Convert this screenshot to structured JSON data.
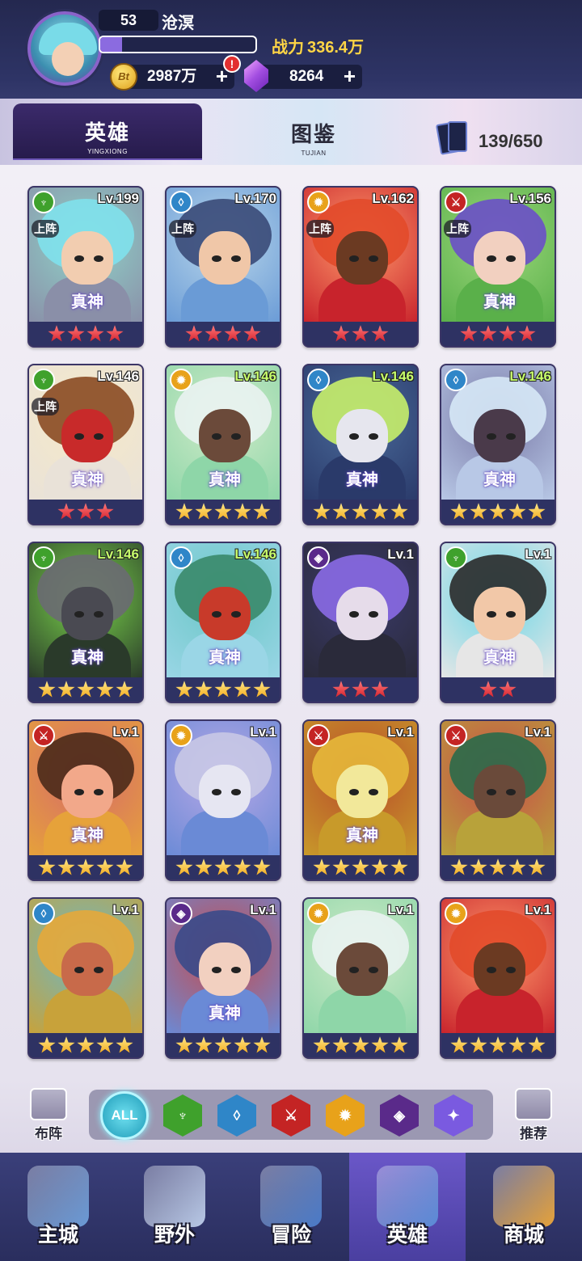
{
  "player": {
    "level": "53",
    "name": "沧溟",
    "exp_fraction": 0.14,
    "power_label": "战力",
    "power_value": "336.4万",
    "coins": "2987万",
    "gems": "8264",
    "coin_icon_text": "Bt",
    "alert": "!"
  },
  "tabs": {
    "hero_label": "英雄",
    "hero_sub": "YINGXIONG",
    "book_label": "图鉴",
    "book_sub": "TUJIAN",
    "collection_count": "139/650"
  },
  "labels": {
    "deployed": "上阵",
    "true_god": "真神"
  },
  "heroes": [
    {
      "level": "Lv.199",
      "faction": "nature",
      "stars": 4,
      "star_color": "red",
      "deployed": true,
      "god": true,
      "art": [
        "#8fd3c8",
        "#7fe1ec",
        "#f2cdb0",
        "#8a8fa8"
      ]
    },
    {
      "level": "Lv.170",
      "faction": "water",
      "stars": 4,
      "star_color": "red",
      "deployed": true,
      "god": false,
      "art": [
        "#b8d6ea",
        "#3a4a78",
        "#f0c7a8",
        "#6a9bd6"
      ]
    },
    {
      "level": "Lv.162",
      "faction": "light",
      "stars": 3,
      "star_color": "red",
      "deployed": true,
      "god": false,
      "art": [
        "#ff9a6a",
        "#e24a2a",
        "#6b3a22",
        "#c8232c"
      ]
    },
    {
      "level": "Lv.156",
      "faction": "fire",
      "stars": 4,
      "star_color": "red",
      "deployed": true,
      "god": true,
      "art": [
        "#9ad67a",
        "#6a4fc8",
        "#f2d0c0",
        "#5ab04a"
      ]
    },
    {
      "level": "Lv.146",
      "faction": "nature",
      "stars": 3,
      "star_color": "red",
      "deployed": true,
      "god": true,
      "art": [
        "#f6e9c8",
        "#8a4a22",
        "#c82a2a",
        "#e9e2d8"
      ]
    },
    {
      "level": "Lv.146",
      "faction": "light",
      "stars": 5,
      "star_color": "gold",
      "deployed": false,
      "god": true,
      "art": [
        "#cfeac8",
        "#eaf3f2",
        "#6b4a3a",
        "#8ed6a8"
      ]
    },
    {
      "level": "Lv.146",
      "faction": "water",
      "stars": 5,
      "star_color": "gold",
      "deployed": false,
      "god": true,
      "art": [
        "#4a6a9a",
        "#c8f06a",
        "#e6e6ee",
        "#2a3a6a"
      ]
    },
    {
      "level": "Lv.146",
      "faction": "water",
      "stars": 5,
      "star_color": "gold",
      "deployed": false,
      "god": true,
      "art": [
        "#7a7aa8",
        "#d6e8f6",
        "#4a3a4a",
        "#b8c8e6"
      ]
    },
    {
      "level": "Lv.146",
      "faction": "nature",
      "stars": 5,
      "star_color": "gold",
      "deployed": false,
      "god": true,
      "art": [
        "#7ad64a",
        "#6a6a72",
        "#4a4a52",
        "#2a3a2a"
      ]
    },
    {
      "level": "Lv.146",
      "faction": "water",
      "stars": 5,
      "star_color": "gold",
      "deployed": false,
      "god": true,
      "art": [
        "#6ac6c6",
        "#3a8a6a",
        "#c83a2a",
        "#9ad6e6"
      ]
    },
    {
      "level": "Lv.1",
      "faction": "shadow",
      "stars": 3,
      "star_color": "red",
      "deployed": false,
      "god": false,
      "art": [
        "#3a3a6a",
        "#8a6ae6",
        "#e6dcea",
        "#2a2a3a"
      ]
    },
    {
      "level": "Lv.1",
      "faction": "nature",
      "stars": 2,
      "star_color": "red",
      "deployed": false,
      "god": true,
      "art": [
        "#6ad6e6",
        "#2a2a2a",
        "#f2c8a8",
        "#e6e6e6"
      ]
    },
    {
      "level": "Lv.1",
      "faction": "fire",
      "stars": 5,
      "star_color": "gold",
      "deployed": false,
      "god": true,
      "art": [
        "#d66a6a",
        "#4a2a1a",
        "#f2a88a",
        "#e6a23a"
      ]
    },
    {
      "level": "Lv.1",
      "faction": "light",
      "stars": 5,
      "star_color": "gold",
      "deployed": false,
      "god": false,
      "art": [
        "#b8a8e6",
        "#c8c8e6",
        "#e6e6f2",
        "#6a8ad6"
      ]
    },
    {
      "level": "Lv.1",
      "faction": "fire",
      "stars": 5,
      "star_color": "gold",
      "deployed": false,
      "god": true,
      "art": [
        "#b84a2a",
        "#e6b83a",
        "#f2e89a",
        "#c89a2a"
      ]
    },
    {
      "level": "Lv.1",
      "faction": "fire",
      "stars": 5,
      "star_color": "gold",
      "deployed": false,
      "god": false,
      "art": [
        "#c84a4a",
        "#2a6a4a",
        "#6a4a3a",
        "#b8a23a"
      ]
    },
    {
      "level": "Lv.1",
      "faction": "water",
      "stars": 5,
      "star_color": "gold",
      "deployed": false,
      "god": false,
      "art": [
        "#6ab8c8",
        "#e6a83a",
        "#c86a4a",
        "#c8a23a"
      ]
    },
    {
      "level": "Lv.1",
      "faction": "shadow",
      "stars": 5,
      "star_color": "gold",
      "deployed": false,
      "god": true,
      "art": [
        "#c84a4a",
        "#3a4a8a",
        "#f2d0c0",
        "#6a8ad6"
      ]
    },
    {
      "level": "Lv.1",
      "faction": "light",
      "stars": 5,
      "star_color": "gold",
      "deployed": false,
      "god": false,
      "art": [
        "#cfeac8",
        "#eaf3f2",
        "#6b4a3a",
        "#8ed6a8"
      ]
    },
    {
      "level": "Lv.1",
      "faction": "light",
      "stars": 5,
      "star_color": "gold",
      "deployed": false,
      "god": false,
      "art": [
        "#ff9a6a",
        "#e24a2a",
        "#6b3a22",
        "#c8232c"
      ]
    }
  ],
  "faction_colors": {
    "nature": "#3fa12c",
    "water": "#2f86c8",
    "light": "#e8a21a",
    "fire": "#c42424",
    "shadow": "#5a2a8a"
  },
  "filter": {
    "left_label": "布阵",
    "right_label": "推荐",
    "all_label": "ALL",
    "icons": [
      {
        "name": "nature",
        "color": "#3fa12c"
      },
      {
        "name": "water",
        "color": "#2f86c8"
      },
      {
        "name": "fire",
        "color": "#c42424"
      },
      {
        "name": "light",
        "color": "#e8a21a"
      },
      {
        "name": "shadow",
        "color": "#5a2a8a"
      },
      {
        "name": "arcane",
        "color": "#7a5ae0"
      }
    ]
  },
  "nav": [
    {
      "label": "主城",
      "color": "#6a9ad6",
      "active": false
    },
    {
      "label": "野外",
      "color": "#b8c8e6",
      "active": false
    },
    {
      "label": "冒险",
      "color": "#4a7ac8",
      "active": false
    },
    {
      "label": "英雄",
      "color": "#5a8ad6",
      "active": true
    },
    {
      "label": "商城",
      "color": "#e6a23a",
      "active": false
    }
  ]
}
